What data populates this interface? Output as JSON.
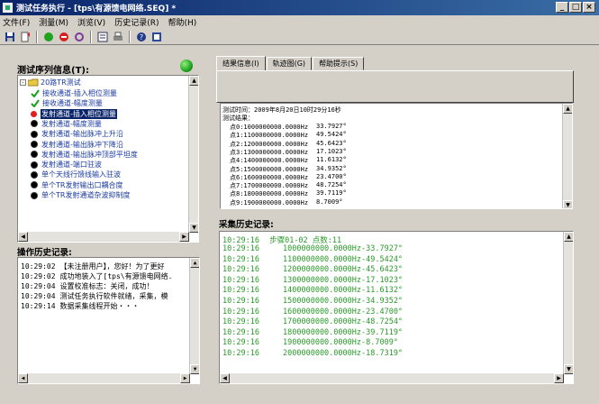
{
  "window": {
    "title": "测试任务执行 - [tps\\有源馈电网络.SEQ] *",
    "min": "_",
    "max": "□",
    "close": "×"
  },
  "menu": [
    "文件(F)",
    "测量(M)",
    "浏览(V)",
    "历史记录(R)",
    "帮助(H)"
  ],
  "toolbar": {
    "icons": [
      "save-icon",
      "run-icon",
      "go-green-icon",
      "stop-red-icon",
      "refresh-icon",
      "list-icon",
      "print-icon",
      "help-icon",
      "about-icon"
    ]
  },
  "left": {
    "sequence_label": "测试序列信息(T):",
    "tree": {
      "root": "20路TR测试",
      "items": [
        {
          "label": "接收通道-插入相位测量",
          "icon": "check"
        },
        {
          "label": "接收通道-幅度测量",
          "icon": "check"
        },
        {
          "label": "发射通道-插入相位测量",
          "icon": "red",
          "selected": true
        },
        {
          "label": "发射通道-幅度测量",
          "icon": "ball"
        },
        {
          "label": "发射通道-输出脉冲上升沿",
          "icon": "ball"
        },
        {
          "label": "发射通道-输出脉冲下降沿",
          "icon": "ball"
        },
        {
          "label": "发射通道-输出脉冲顶部平坦度",
          "icon": "ball"
        },
        {
          "label": "发射通道-端口驻波",
          "icon": "ball"
        },
        {
          "label": "单个天线行馈线输入驻波",
          "icon": "ball"
        },
        {
          "label": "单个TR发射输出口耦合度",
          "icon": "ball"
        },
        {
          "label": "单个TR发射通道杂波抑制度",
          "icon": "ball"
        }
      ]
    },
    "history_label": "操作历史记录:",
    "history": [
      {
        "time": "10:29:02",
        "text": "【未注册用户】，您好！为了更好"
      },
      {
        "time": "10:29:02",
        "text": "成功地装入了[tps\\有源馈电网络."
      },
      {
        "time": "10:29:04",
        "text": "设置校准标志：关闭，成功！"
      },
      {
        "time": "10:29:04",
        "text": "测试任务执行软件就绪，采集，模"
      },
      {
        "time": "10:29:14",
        "text": "数据采集线程开始・・・"
      }
    ]
  },
  "right": {
    "tabs": [
      "结果信息(I)",
      "轨迹图(G)",
      "帮助提示(S)"
    ],
    "result": {
      "time_line": "测试时间：2009年8月20日10时29分16秒",
      "result_label": "测试结果：",
      "points": [
        {
          "name": "点0:1000000000.0000Hz",
          "value": "33.7927°"
        },
        {
          "name": "点1:1100000000.0000Hz",
          "value": "49.5424°"
        },
        {
          "name": "点2:1200000000.0000Hz",
          "value": "45.6423°"
        },
        {
          "name": "点3:1300000000.0000Hz",
          "value": "17.1023°"
        },
        {
          "name": "点4:1400000000.0000Hz",
          "value": "11.6132°"
        },
        {
          "name": "点5:1500000000.0000Hz",
          "value": "34.9352°"
        },
        {
          "name": "点6:1600000000.0000Hz",
          "value": "23.4700°"
        },
        {
          "name": "点7:1700000000.0000Hz",
          "value": "48.7254°"
        },
        {
          "name": "点8:1800000000.0000Hz",
          "value": "39.7119°"
        },
        {
          "name": "点9:1900000000.0000Hz",
          "value": "8.7009°"
        }
      ]
    },
    "collect_label": "采集历史记录:",
    "collect_header": {
      "time": "10:29:16",
      "text": "步骤01-02 点数:11"
    },
    "collect_rows": [
      {
        "time": "10:29:16",
        "text": "1000000000.0000Hz-33.7927°"
      },
      {
        "time": "10:29:16",
        "text": "1100000000.0000Hz-49.5424°"
      },
      {
        "time": "10:29:16",
        "text": "1200000000.0000Hz-45.6423°"
      },
      {
        "time": "10:29:16",
        "text": "1300000000.0000Hz-17.1023°"
      },
      {
        "time": "10:29:16",
        "text": "1400000000.0000Hz-11.6132°"
      },
      {
        "time": "10:29:16",
        "text": "1500000000.0000Hz-34.9352°"
      },
      {
        "time": "10:29:16",
        "text": "1600000000.0000Hz-23.4700°"
      },
      {
        "time": "10:29:16",
        "text": "1700000000.0000Hz-48.7254°"
      },
      {
        "time": "10:29:16",
        "text": "1800000000.0000Hz-39.7119°"
      },
      {
        "time": "10:29:16",
        "text": "1900000000.0000Hz-8.7009°"
      },
      {
        "time": "10:29:16",
        "text": "2000000000.0000Hz-18.7319°"
      }
    ]
  },
  "colors": {
    "status_green": "#1fa31f",
    "history_text": "#2a9a2a",
    "titlebar": "#0a246a"
  }
}
